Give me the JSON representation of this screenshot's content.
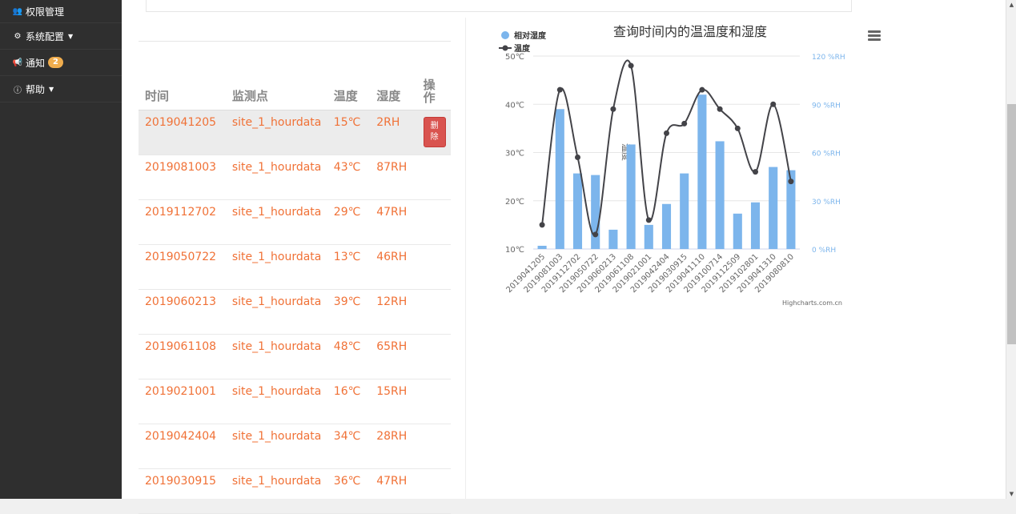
{
  "sidebar": {
    "items": [
      {
        "label": "权限管理",
        "icon": "users-icon",
        "caret": false
      },
      {
        "label": "系统配置",
        "icon": "cogs-icon",
        "caret": true
      },
      {
        "label": "通知",
        "icon": "bullhorn-icon",
        "badge": "2"
      },
      {
        "label": "帮助",
        "icon": "info-circle-icon",
        "caret": true
      }
    ]
  },
  "table": {
    "headers": {
      "time": "时间",
      "site": "监测点",
      "temp": "温度",
      "humidity": "湿度",
      "action": "操作"
    },
    "delete_label": "删除",
    "rows": [
      {
        "time": "2019041205",
        "site": "site_1_hourdata",
        "temp": "15℃",
        "humidity": "2RH"
      },
      {
        "time": "2019081003",
        "site": "site_1_hourdata",
        "temp": "43℃",
        "humidity": "87RH"
      },
      {
        "time": "2019112702",
        "site": "site_1_hourdata",
        "temp": "29℃",
        "humidity": "47RH"
      },
      {
        "time": "2019050722",
        "site": "site_1_hourdata",
        "temp": "13℃",
        "humidity": "46RH"
      },
      {
        "time": "2019060213",
        "site": "site_1_hourdata",
        "temp": "39℃",
        "humidity": "12RH"
      },
      {
        "time": "2019061108",
        "site": "site_1_hourdata",
        "temp": "48℃",
        "humidity": "65RH"
      },
      {
        "time": "2019021001",
        "site": "site_1_hourdata",
        "temp": "16℃",
        "humidity": "15RH"
      },
      {
        "time": "2019042404",
        "site": "site_1_hourdata",
        "temp": "34℃",
        "humidity": "28RH"
      },
      {
        "time": "2019030915",
        "site": "site_1_hourdata",
        "temp": "36℃",
        "humidity": "47RH"
      }
    ]
  },
  "chart_data": {
    "type": "bar",
    "title": "查询时间内的温温度和湿度",
    "credits": "Highcharts.com.cn",
    "categories": [
      "2019041205",
      "2019081003",
      "2019112702",
      "2019050722",
      "2019060213",
      "2019061108",
      "2019021001",
      "2019042404",
      "2019030915",
      "2019041110",
      "2019100714",
      "2019112509",
      "2019102801",
      "2019041310",
      "2019080810"
    ],
    "series": [
      {
        "name": "相对湿度",
        "type": "bar",
        "axis": "right",
        "color": "#7cb5ec",
        "values": [
          2,
          87,
          47,
          46,
          12,
          65,
          15,
          28,
          47,
          96,
          67,
          22,
          29,
          51,
          49
        ]
      },
      {
        "name": "温度",
        "type": "line",
        "axis": "left",
        "color": "#434348",
        "values": [
          15,
          43,
          29,
          13,
          39,
          48,
          16,
          34,
          36,
          43,
          39,
          35,
          26,
          40,
          24
        ]
      }
    ],
    "y_left": {
      "label": "温度",
      "ticks": [
        "10℃",
        "20℃",
        "30℃",
        "40℃",
        "50℃"
      ],
      "range": [
        10,
        50
      ]
    },
    "y_right": {
      "label": "湿度",
      "ticks": [
        "0 %RH",
        "30 %RH",
        "60 %RH",
        "90 %RH",
        "120 %RH"
      ],
      "range": [
        0,
        120
      ]
    },
    "legend_position": "top-left"
  }
}
